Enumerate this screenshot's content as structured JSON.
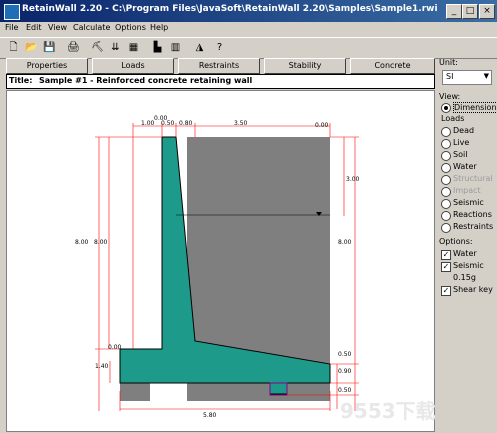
{
  "window": {
    "title": "RetainWall 2.20 - C:\\Program Files\\JavaSoft\\RetainWall 2.20\\Samples\\Sample1.rwi",
    "minimize": "_",
    "maximize": "□",
    "close": "×"
  },
  "menu": [
    "File",
    "Edit",
    "View",
    "Calculate",
    "Options",
    "Help"
  ],
  "toolbar_icons": [
    "new-file-icon",
    "open-folder-icon",
    "save-icon",
    "print-icon",
    "soil-icon",
    "loads-icon",
    "grid-icon",
    "wall-icon",
    "pile-icon",
    "design-icon",
    "help-icon"
  ],
  "tabs": [
    "Properties",
    "Loads",
    "Restraints",
    "Stability",
    "Concrete"
  ],
  "title_field": {
    "label": "Title:",
    "value": "Sample #1 - Reinforced concrete retaining wall"
  },
  "unit": {
    "label": "Unit:",
    "value": "SI"
  },
  "view": {
    "label": "View:",
    "dimensions": "Dimensions",
    "loads_label": "Loads",
    "items": [
      "Dead",
      "Live",
      "Soil",
      "Water",
      "Structural",
      "Impact",
      "Seismic",
      "Reactions",
      "Restraints"
    ],
    "disabled": [
      "Structural",
      "Impact"
    ]
  },
  "options": {
    "label": "Options:",
    "water": "Water",
    "seismic": "Seismic",
    "seismic_value": "0.15g",
    "shear_key": "Shear key"
  },
  "drawing": {
    "dims": {
      "top_stem": "0.00",
      "toe_width": "1.00",
      "stem_top": "0.50",
      "batter": "0.80",
      "heel": "3.50",
      "backfill_slope": "0.00",
      "water_depth": "3.00",
      "left_outer": "8.00",
      "left_inner": "8.00",
      "right_height": "8.00",
      "toe_soil": "0.00",
      "footing_total": "1.40",
      "key_top": "0.50",
      "footing": "0.90",
      "key": "0.50",
      "base_width": "5.80"
    },
    "colors": {
      "wall": "#1e9a8a",
      "soil": "#7f7f7f",
      "key_outline": "#8b008b"
    }
  },
  "watermark": "9553下载"
}
